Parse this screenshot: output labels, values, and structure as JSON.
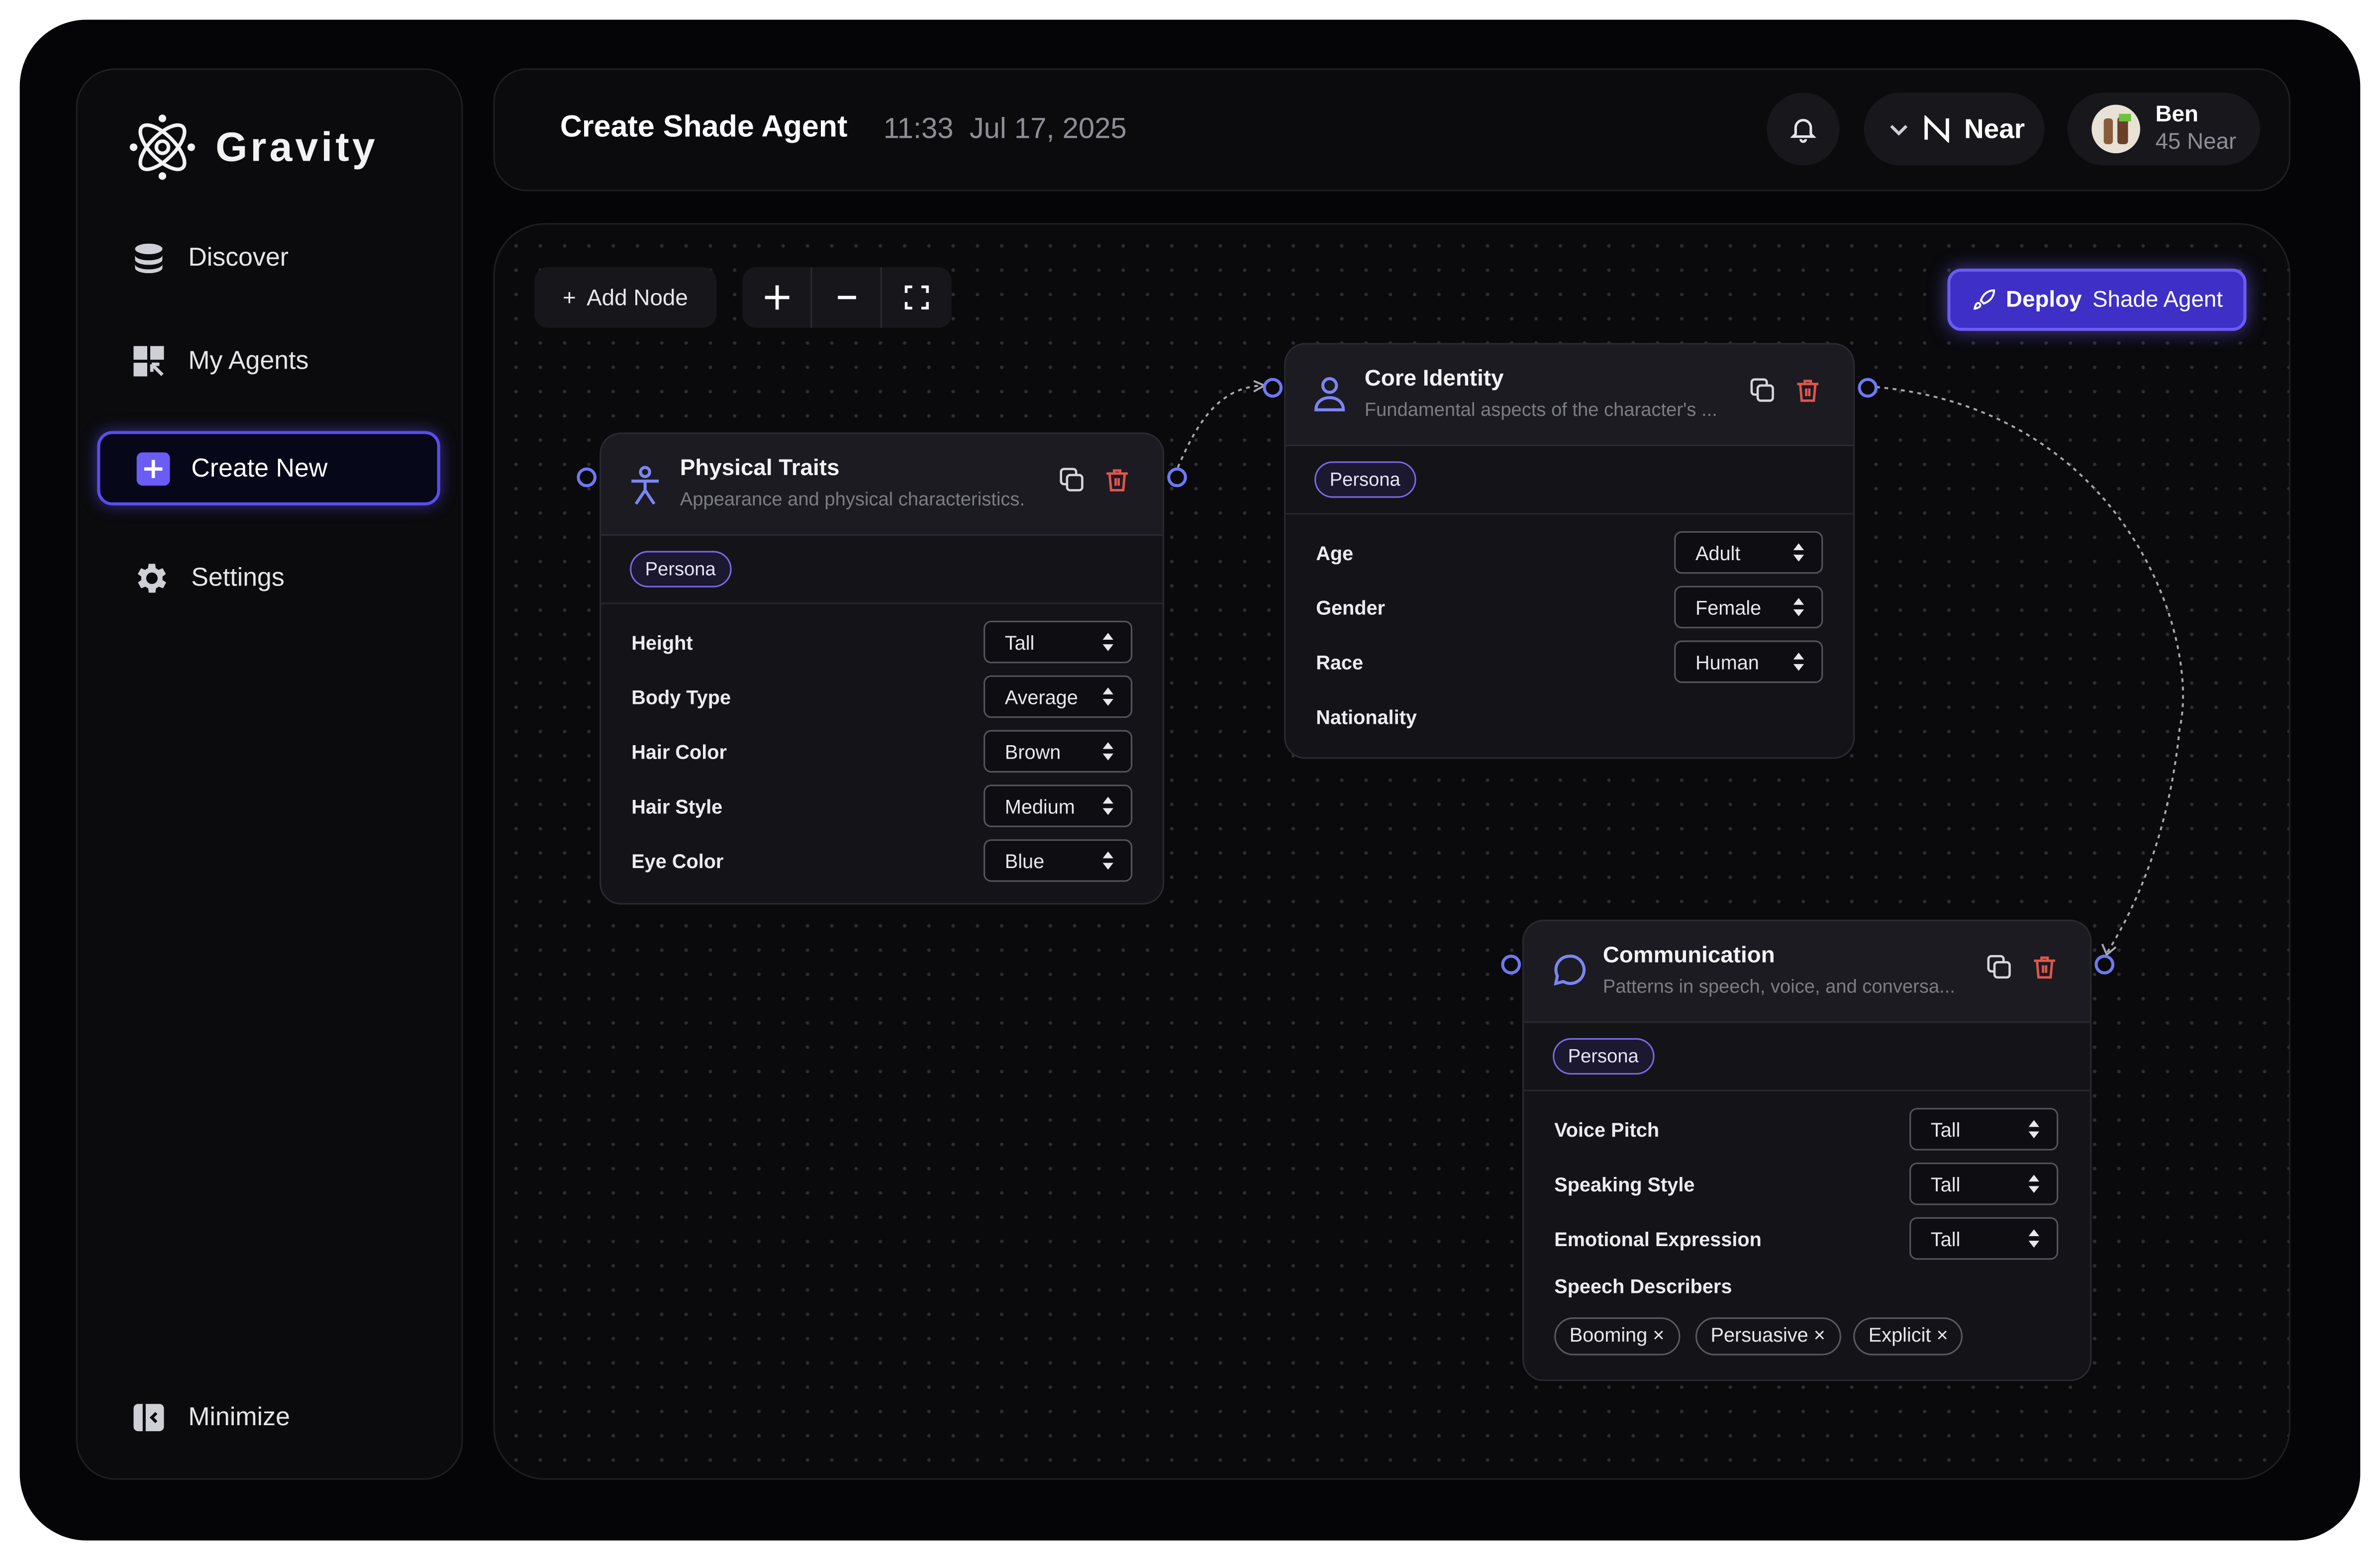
{
  "app": {
    "name": "Gravity"
  },
  "sidebar": {
    "items": [
      {
        "label": "Discover",
        "icon": "database-icon"
      },
      {
        "label": "My Agents",
        "icon": "dashboard-grid-icon"
      },
      {
        "label": "Create New",
        "icon": "plus-square-icon",
        "active": true
      },
      {
        "label": "Settings",
        "icon": "gear-icon"
      }
    ],
    "minimize_label": "Minimize"
  },
  "header": {
    "title": "Create Shade Agent",
    "time": "11:33",
    "date": "Jul 17, 2025",
    "network": "Near",
    "user": {
      "name": "Ben",
      "balance": "45 Near"
    }
  },
  "toolbar": {
    "add_node": "Add Node",
    "add_node_prefix": "+",
    "zoom_in": "+",
    "zoom_out": "−",
    "deploy_bold": "Deploy",
    "deploy_rest": "Shade Agent"
  },
  "nodes": {
    "physical": {
      "title": "Physical Traits",
      "subtitle": "Appearance and physical characteristics.",
      "tag": "Persona",
      "fields": [
        {
          "label": "Height",
          "value": "Tall"
        },
        {
          "label": "Body Type",
          "value": "Average"
        },
        {
          "label": "Hair Color",
          "value": "Brown"
        },
        {
          "label": "Hair Style",
          "value": "Medium"
        },
        {
          "label": "Eye Color",
          "value": "Blue"
        }
      ]
    },
    "core": {
      "title": "Core Identity",
      "subtitle": "Fundamental aspects of the character's ...",
      "tag": "Persona",
      "fields": [
        {
          "label": "Age",
          "value": "Adult"
        },
        {
          "label": "Gender",
          "value": "Female"
        },
        {
          "label": "Race",
          "value": "Human"
        },
        {
          "label": "Nationality",
          "value": ""
        }
      ]
    },
    "communication": {
      "title": "Communication",
      "subtitle": "Patterns in speech, voice, and conversa...",
      "tag": "Persona",
      "fields": [
        {
          "label": "Voice Pitch",
          "value": "Tall"
        },
        {
          "label": "Speaking Style",
          "value": "Tall"
        },
        {
          "label": "Emotional Expression",
          "value": "Tall"
        }
      ],
      "describers_label": "Speech Describers",
      "describers": [
        "Booming",
        "Persuasive",
        "Explicit"
      ]
    }
  },
  "colors": {
    "accent": "#5a4cf0",
    "danger": "#e0564d",
    "port": "#6f79f2"
  }
}
